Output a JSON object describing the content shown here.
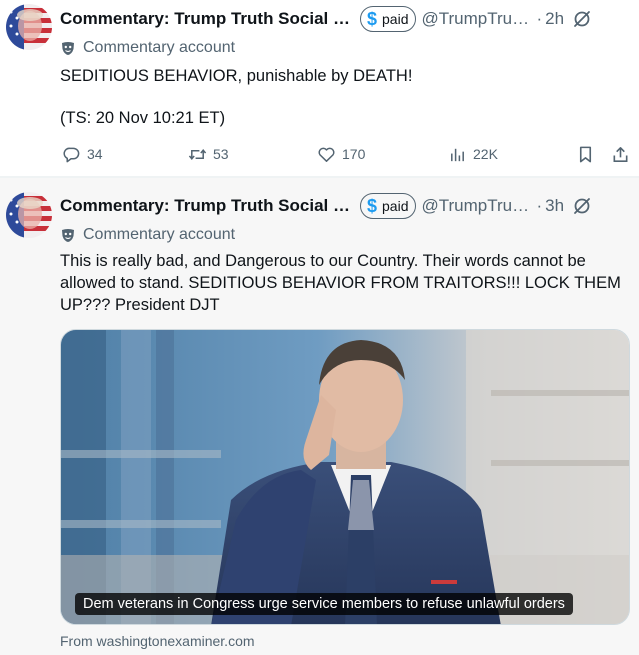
{
  "posts": [
    {
      "author": "Commentary: Trump Truth Social P...",
      "badge": {
        "icon": "dollar-icon",
        "label": "paid"
      },
      "handle": "@TrumpTrut...",
      "separator": "·",
      "time": "2h",
      "account_label": "Commentary account",
      "text_line_1": "SEDITIOUS BEHAVIOR, punishable by DEATH!",
      "text_line_2": "(TS: 20 Nov 10:21 ET)",
      "actions": {
        "replies": "34",
        "reposts": "53",
        "likes": "170",
        "views": "22K"
      }
    },
    {
      "author": "Commentary: Trump Truth Social P...",
      "badge": {
        "icon": "dollar-icon",
        "label": "paid"
      },
      "handle": "@TrumpTrut...",
      "separator": "·",
      "time": "3h",
      "account_label": "Commentary account",
      "text": "This is really bad, and Dangerous to our Country. Their words cannot be allowed to stand. SEDITIOUS BEHAVIOR FROM TRAITORS!!! LOCK THEM UP??? President DJT",
      "card": {
        "caption": "Dem veterans in Congress urge service members to refuse unlawful orders",
        "source": "From washingtonexaminer.com"
      }
    }
  ],
  "colors": {
    "text_primary": "#0f1419",
    "text_secondary": "#536471",
    "accent": "#1d9bf0",
    "post_2_background": "#f7f7f7"
  }
}
